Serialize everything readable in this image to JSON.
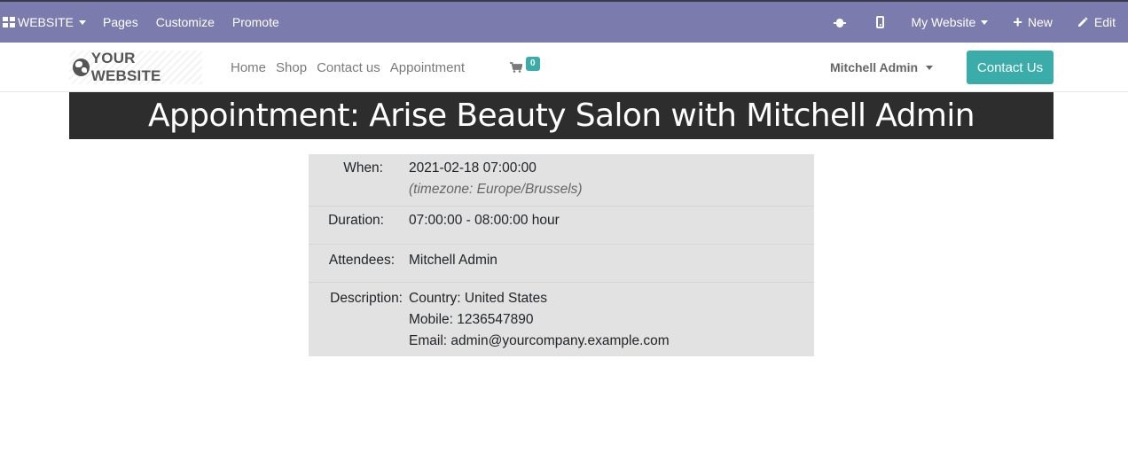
{
  "admin_bar": {
    "apps_label": "WEBSITE",
    "menu": [
      "Pages",
      "Customize",
      "Promote"
    ],
    "website_switcher": "My Website",
    "new_label": "New",
    "edit_label": "Edit"
  },
  "navbar": {
    "logo_text": "YOUR WEBSITE",
    "links": [
      "Home",
      "Shop",
      "Contact us",
      "Appointment"
    ],
    "cart_count": "0",
    "user_name": "Mitchell Admin",
    "contact_button": "Contact Us"
  },
  "title": "Appointment: Arise Beauty Salon with Mitchell Admin",
  "details": {
    "when_label": "When:",
    "when_value": "2021-02-18 07:00:00",
    "timezone": "(timezone: Europe/Brussels)",
    "duration_label": "Duration:",
    "duration_value": "07:00:00 - 08:00:00 hour",
    "attendees_label": "Attendees:",
    "attendees_value": "Mitchell Admin",
    "description_label": "Description:",
    "description_lines": [
      "Country: United States",
      "Mobile: 1236547890",
      "Email: admin@yourcompany.example.com"
    ]
  },
  "colors": {
    "admin_bar": "#7c7bad",
    "accent": "#3aadaa",
    "banner": "#2d2d2d",
    "details_bg": "#e2e2e2"
  },
  "icons": [
    "apps-grid-icon",
    "bug-icon",
    "mobile-icon",
    "plus-icon",
    "pencil-icon",
    "globe-icon",
    "cart-icon"
  ]
}
